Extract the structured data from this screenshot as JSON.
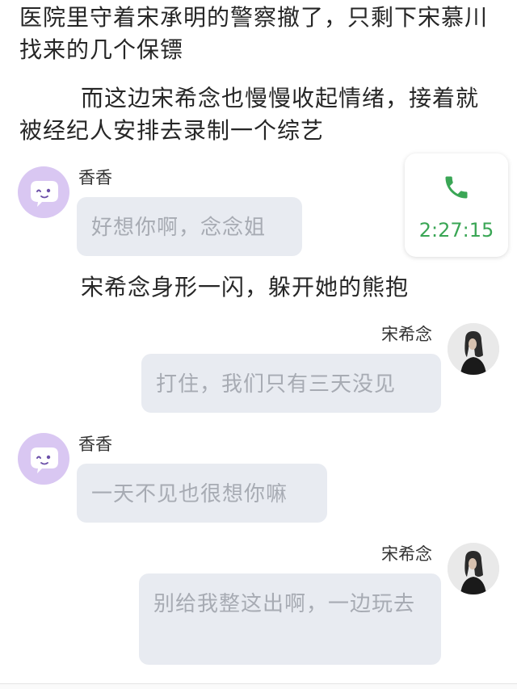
{
  "story": {
    "paragraph_1": "医院里守着宋承明的警察撤了，只剩下宋慕川找来的几个保镖",
    "paragraph_2": "而这边宋希念也慢慢收起情绪，接着就被经纪人安排去录制一个综艺",
    "paragraph_3": "宋希念身形一闪，躲开她的熊抱"
  },
  "call_card": {
    "icon": "phone-icon",
    "duration": "2:27:15",
    "accent_color": "#3aa655"
  },
  "messages": [
    {
      "sender": "香香",
      "side": "left",
      "avatar": "cartoon-avatar",
      "text": "好想你啊，念念姐"
    },
    {
      "sender": "宋希念",
      "side": "right",
      "avatar": "photo-avatar",
      "text": "打住，我们只有三天没见"
    },
    {
      "sender": "香香",
      "side": "left",
      "avatar": "cartoon-avatar",
      "text": "一天不见也很想你嘛"
    },
    {
      "sender": "宋希念",
      "side": "right",
      "avatar": "photo-avatar",
      "text": "别给我整这出啊，一边玩去"
    }
  ],
  "colors": {
    "bubble_bg": "#e8ebf1",
    "bubble_text": "#a7abb3",
    "cartoon_avatar_bg": "#d9c7f2"
  }
}
